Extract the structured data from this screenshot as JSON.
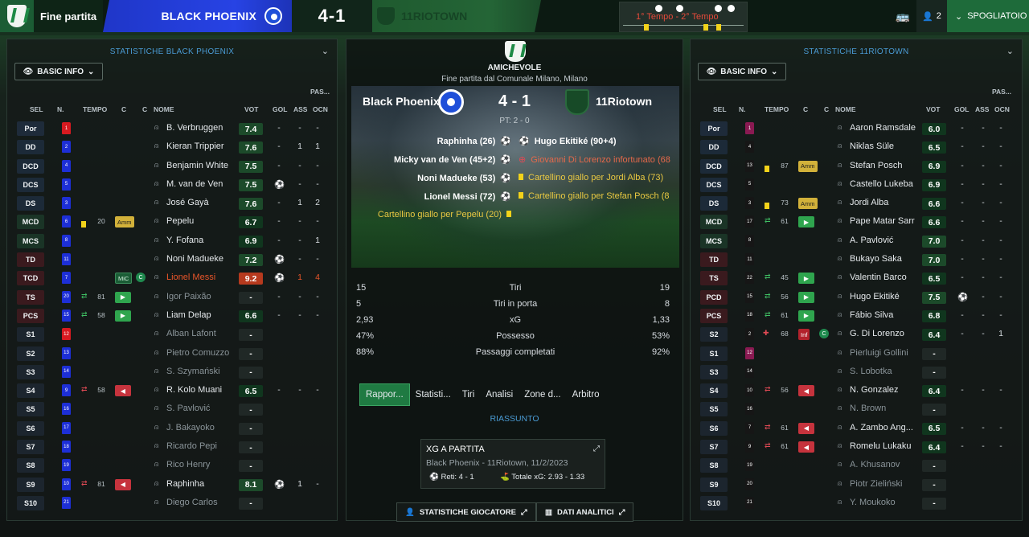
{
  "topbar": {
    "status": "Fine partita",
    "home_team": "BLACK PHOENIX",
    "score": "4-1",
    "away_team": "11RIOTOWN",
    "timeline_label": "1° Tempo - 2° Tempo",
    "users_count": "2",
    "dressing_room": "SPOGLIATOIO"
  },
  "left_panel": {
    "title": "STATISTICHE BLACK PHOENIX",
    "filter": "BASIC INFO",
    "headers": {
      "pas_top": "PAS...",
      "sel": "SEL",
      "n": "N.",
      "tempo": "TEMPO",
      "c1": "C",
      "c2": "C",
      "nome": "NOME",
      "vot": "VOT",
      "gol": "GOL",
      "ass": "ASS",
      "ocn": "OCN"
    },
    "rows": [
      {
        "pos": "Por",
        "num": "1",
        "name": "B. Verbruggen",
        "vot": "7.4",
        "gol": "-",
        "ass": "-",
        "ocn": "-"
      },
      {
        "pos": "DD",
        "num": "2",
        "name": "Kieran Trippier",
        "vot": "7.6",
        "gol": "-",
        "ass": "1",
        "ocn": "1"
      },
      {
        "pos": "DCD",
        "num": "4",
        "name": "Benjamin White",
        "vot": "7.5",
        "gol": "-",
        "ass": "-",
        "ocn": "-"
      },
      {
        "pos": "DCS",
        "num": "5",
        "name": "M. van de Ven",
        "vot": "7.5",
        "gol": "⚽",
        "ass": "-",
        "ocn": "-"
      },
      {
        "pos": "DS",
        "num": "3",
        "name": "José Gayà",
        "vot": "7.6",
        "gol": "-",
        "ass": "1",
        "ocn": "2"
      },
      {
        "pos": "MCD",
        "num": "6",
        "tempo": "20",
        "badge": "Amm",
        "name": "Pepelu",
        "vot": "6.7",
        "gol": "-",
        "ass": "-",
        "ocn": "-"
      },
      {
        "pos": "MCS",
        "num": "8",
        "name": "Y. Fofana",
        "vot": "6.9",
        "gol": "-",
        "ass": "-",
        "ocn": "1"
      },
      {
        "pos": "TD",
        "num": "11",
        "name": "Noni Madueke",
        "vot": "7.2",
        "gol": "⚽",
        "ass": "-",
        "ocn": "-"
      },
      {
        "pos": "TCD",
        "num": "7",
        "badge": "MiC",
        "c": "C",
        "name": "Lionel Messi",
        "vot": "9.2",
        "gol": "⚽",
        "ass": "1",
        "ocn": "4"
      },
      {
        "pos": "TS",
        "num": "20",
        "tempo": "81",
        "name": "Igor Paixão",
        "vot": "-",
        "gol": "-",
        "ass": "-",
        "ocn": "-"
      },
      {
        "pos": "PCS",
        "num": "15",
        "tempo": "58",
        "name": "Liam Delap",
        "vot": "6.6",
        "gol": "-",
        "ass": "-",
        "ocn": "-"
      },
      {
        "pos": "S1",
        "num": "12",
        "name": "Alban Lafont",
        "vot": "-",
        "gol": "",
        "ass": "",
        "ocn": ""
      },
      {
        "pos": "S2",
        "num": "13",
        "name": "Pietro Comuzzo",
        "vot": "-",
        "gol": "",
        "ass": "",
        "ocn": ""
      },
      {
        "pos": "S3",
        "num": "14",
        "name": "S. Szymański",
        "vot": "-",
        "gol": "",
        "ass": "",
        "ocn": ""
      },
      {
        "pos": "S4",
        "num": "9",
        "tempo": "58",
        "name": "R. Kolo Muani",
        "vot": "6.5",
        "gol": "-",
        "ass": "-",
        "ocn": "-"
      },
      {
        "pos": "S5",
        "num": "16",
        "name": "S. Pavlović",
        "vot": "-",
        "gol": "",
        "ass": "",
        "ocn": ""
      },
      {
        "pos": "S6",
        "num": "17",
        "name": "J. Bakayoko",
        "vot": "-",
        "gol": "",
        "ass": "",
        "ocn": ""
      },
      {
        "pos": "S7",
        "num": "18",
        "name": "Ricardo Pepi",
        "vot": "-",
        "gol": "",
        "ass": "",
        "ocn": ""
      },
      {
        "pos": "S8",
        "num": "19",
        "name": "Rico Henry",
        "vot": "-",
        "gol": "",
        "ass": "",
        "ocn": ""
      },
      {
        "pos": "S9",
        "num": "10",
        "tempo": "81",
        "name": "Raphinha",
        "vot": "8.1",
        "gol": "⚽",
        "ass": "1",
        "ocn": "-"
      },
      {
        "pos": "S10",
        "num": "21",
        "name": "Diego Carlos",
        "vot": "-",
        "gol": "",
        "ass": "",
        "ocn": ""
      }
    ]
  },
  "right_panel": {
    "title": "STATISTICHE 11RIOTOWN",
    "filter": "BASIC INFO",
    "headers": {
      "pas_top": "PAS...",
      "sel": "SEL",
      "n": "N.",
      "tempo": "TEMPO",
      "c1": "C",
      "c2": "C",
      "nome": "NOME",
      "vot": "VOT",
      "gol": "GOL",
      "ass": "ASS",
      "ocn": "OCN"
    },
    "rows": [
      {
        "pos": "Por",
        "num": "1",
        "name": "Aaron Ramsdale",
        "vot": "6.0",
        "gol": "-",
        "ass": "-",
        "ocn": "-"
      },
      {
        "pos": "DD",
        "num": "4",
        "name": "Niklas Süle",
        "vot": "6.5",
        "gol": "-",
        "ass": "-",
        "ocn": "-"
      },
      {
        "pos": "DCD",
        "num": "13",
        "tempo": "87",
        "badge": "Amm",
        "name": "Stefan Posch",
        "vot": "6.9",
        "gol": "-",
        "ass": "-",
        "ocn": "-"
      },
      {
        "pos": "DCS",
        "num": "5",
        "name": "Castello Lukeba",
        "vot": "6.9",
        "gol": "-",
        "ass": "-",
        "ocn": "-"
      },
      {
        "pos": "DS",
        "num": "3",
        "tempo": "73",
        "badge": "Amm",
        "name": "Jordi Alba",
        "vot": "6.6",
        "gol": "-",
        "ass": "-",
        "ocn": "-"
      },
      {
        "pos": "MCD",
        "num": "17",
        "tempo": "61",
        "name": "Pape Matar Sarr",
        "vot": "6.6",
        "gol": "-",
        "ass": "-",
        "ocn": "-"
      },
      {
        "pos": "MCS",
        "num": "8",
        "name": "A. Pavlović",
        "vot": "7.0",
        "gol": "-",
        "ass": "-",
        "ocn": "-"
      },
      {
        "pos": "TD",
        "num": "11",
        "name": "Bukayo Saka",
        "vot": "7.0",
        "gol": "-",
        "ass": "-",
        "ocn": "-"
      },
      {
        "pos": "TS",
        "num": "22",
        "tempo": "45",
        "name": "Valentin Barco",
        "vot": "6.5",
        "gol": "-",
        "ass": "-",
        "ocn": "-"
      },
      {
        "pos": "PCD",
        "num": "15",
        "tempo": "56",
        "name": "Hugo Ekitiké",
        "vot": "7.5",
        "gol": "⚽",
        "ass": "-",
        "ocn": "-"
      },
      {
        "pos": "PCS",
        "num": "18",
        "tempo": "61",
        "name": "Fábio Silva",
        "vot": "6.8",
        "gol": "-",
        "ass": "-",
        "ocn": "-"
      },
      {
        "pos": "S2",
        "num": "2",
        "tempo": "68",
        "badge": "Inf",
        "c": "C",
        "name": "G. Di Lorenzo",
        "vot": "6.4",
        "gol": "-",
        "ass": "-",
        "ocn": "1"
      },
      {
        "pos": "S1",
        "num": "12",
        "name": "Pierluigi Gollini",
        "vot": "-",
        "gol": "",
        "ass": "",
        "ocn": ""
      },
      {
        "pos": "S3",
        "num": "14",
        "name": "S. Lobotka",
        "vot": "-",
        "gol": "",
        "ass": "",
        "ocn": ""
      },
      {
        "pos": "S4",
        "num": "10",
        "tempo": "56",
        "name": "N. Gonzalez",
        "vot": "6.4",
        "gol": "-",
        "ass": "-",
        "ocn": "-"
      },
      {
        "pos": "S5",
        "num": "16",
        "name": "N. Brown",
        "vot": "-",
        "gol": "",
        "ass": "",
        "ocn": ""
      },
      {
        "pos": "S6",
        "num": "7",
        "tempo": "61",
        "name": "A. Zambo Ang...",
        "vot": "6.5",
        "gol": "-",
        "ass": "-",
        "ocn": "-"
      },
      {
        "pos": "S7",
        "num": "9",
        "tempo": "61",
        "name": "Romelu Lukaku",
        "vot": "6.4",
        "gol": "-",
        "ass": "-",
        "ocn": "-"
      },
      {
        "pos": "S8",
        "num": "19",
        "name": "A. Khusanov",
        "vot": "-",
        "gol": "",
        "ass": "",
        "ocn": ""
      },
      {
        "pos": "S9",
        "num": "20",
        "name": "Piotr Zieliński",
        "vot": "-",
        "gol": "",
        "ass": "",
        "ocn": ""
      },
      {
        "pos": "S10",
        "num": "21",
        "name": "Y. Moukoko",
        "vot": "-",
        "gol": "",
        "ass": "",
        "ocn": ""
      }
    ]
  },
  "center": {
    "competition": "AMICHEVOLE",
    "venue": "Fine partita dal Comunale Milano, Milano",
    "home": "Black Phoenix",
    "score": "4 - 1",
    "away": "11Riotown",
    "halftime": "PT: 2 - 0",
    "events_left": [
      {
        "text": "Raphinha (26)",
        "type": "goal"
      },
      {
        "text": "Micky van de Ven (45+2)",
        "type": "goal"
      },
      {
        "text": "Noni Madueke (53)",
        "type": "goal"
      },
      {
        "text": "Lionel Messi (72)",
        "type": "goal"
      },
      {
        "text": "Cartellino giallo per Pepelu (20)",
        "type": "yellow"
      }
    ],
    "events_right": [
      {
        "text": "Hugo Ekitiké (90+4)",
        "type": "goal"
      },
      {
        "text": "Giovanni Di Lorenzo infortunato (68",
        "type": "injury"
      },
      {
        "text": "Cartellino giallo per Jordi Alba (73)",
        "type": "yellow"
      },
      {
        "text": "Cartellino giallo per Stefan Posch (8",
        "type": "yellow"
      }
    ],
    "stats": [
      {
        "home": "15",
        "label": "Tiri",
        "away": "19"
      },
      {
        "home": "5",
        "label": "Tiri in porta",
        "away": "8"
      },
      {
        "home": "2,93",
        "label": "xG",
        "away": "1,33"
      },
      {
        "home": "47%",
        "label": "Possesso",
        "away": "53%"
      },
      {
        "home": "88%",
        "label": "Passaggi completati",
        "away": "92%"
      }
    ],
    "tabs": [
      "Rappor...",
      "Statisti...",
      "Tiri",
      "Analisi",
      "Zone d...",
      "Arbitro"
    ],
    "summary_label": "RIASSUNTO",
    "xg_card": {
      "title": "XG A PARTITA",
      "subtitle": "Black Phoenix - 11Riotown, 11/2/2023",
      "goals": "Reti: 4 - 1",
      "total_xg": "Totale xG: 2.93 - 1.33"
    },
    "btn_players": "STATISTICHE GIOCATORE",
    "btn_analytics": "DATI ANALITICI"
  }
}
